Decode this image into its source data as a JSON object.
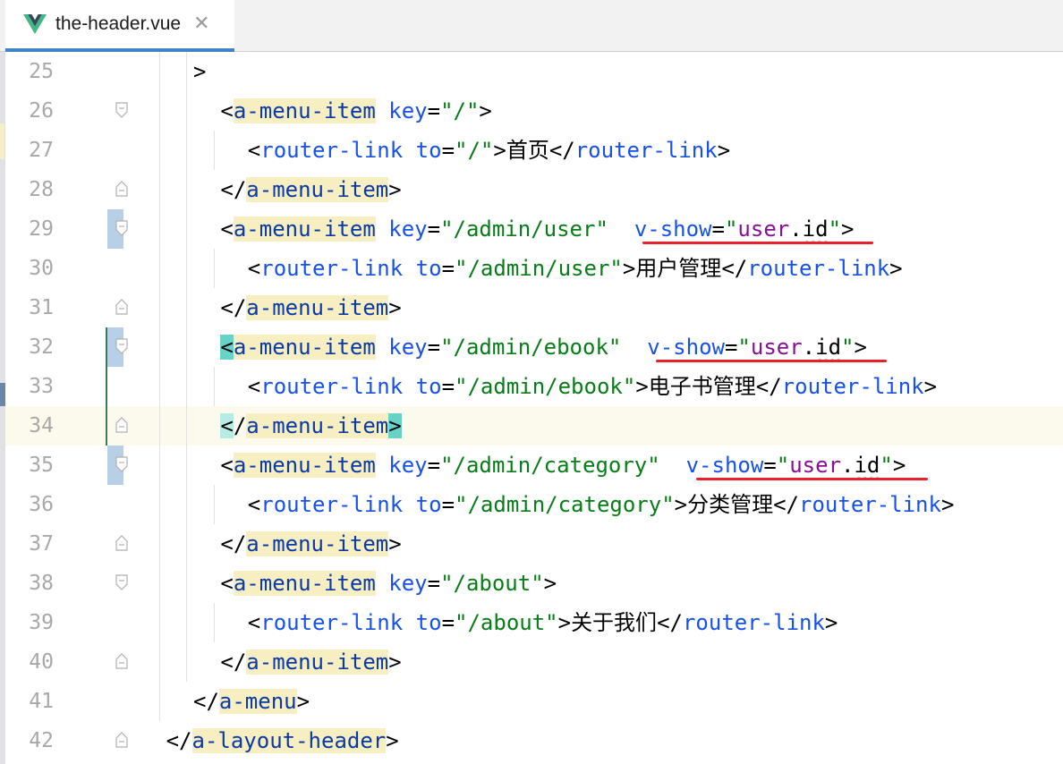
{
  "tab": {
    "title": "the-header.vue",
    "close_glyph": "✕",
    "icon": "vue-logo-icon",
    "icon_colors": {
      "outer": "#41b883",
      "inner": "#34495e"
    }
  },
  "editor": {
    "current_line": 34,
    "lines": [
      {
        "n": "25",
        "indent": 0,
        "parts": [
          [
            "punct",
            ">"
          ]
        ]
      },
      {
        "n": "26",
        "indent": 1,
        "parts": [
          [
            "punct",
            "<"
          ],
          [
            "tag",
            "a-menu-item"
          ],
          [
            "txt",
            " "
          ],
          [
            "attr",
            "key"
          ],
          [
            "punct",
            "="
          ],
          [
            "val",
            "\"/\""
          ],
          [
            "punct",
            ">"
          ]
        ]
      },
      {
        "n": "27",
        "indent": 2,
        "parts": [
          [
            "punct",
            "<"
          ],
          [
            "attr",
            "router-link"
          ],
          [
            "txt",
            " "
          ],
          [
            "attr",
            "to"
          ],
          [
            "punct",
            "="
          ],
          [
            "val",
            "\"/\""
          ],
          [
            "punct",
            ">"
          ],
          [
            "txt",
            "首页"
          ],
          [
            "punct",
            "</"
          ],
          [
            "attr",
            "router-link"
          ],
          [
            "punct",
            ">"
          ]
        ]
      },
      {
        "n": "28",
        "indent": 1,
        "parts": [
          [
            "punct",
            "</"
          ],
          [
            "tag",
            "a-menu-item"
          ],
          [
            "punct",
            ">"
          ]
        ]
      },
      {
        "n": "29",
        "indent": 1,
        "parts": [
          [
            "punct",
            "<"
          ],
          [
            "tag",
            "a-menu-item"
          ],
          [
            "txt",
            " "
          ],
          [
            "attr",
            "key"
          ],
          [
            "punct",
            "="
          ],
          [
            "val",
            "\"/admin/user\""
          ],
          [
            "txt",
            "  "
          ],
          [
            "attr",
            "v-show"
          ],
          [
            "punct",
            "="
          ],
          [
            "val",
            "\""
          ],
          [
            "var",
            "user"
          ],
          [
            "punct",
            "."
          ],
          [
            "squig",
            "id"
          ],
          [
            "val",
            "\""
          ],
          [
            "punct",
            ">"
          ]
        ]
      },
      {
        "n": "30",
        "indent": 2,
        "parts": [
          [
            "punct",
            "<"
          ],
          [
            "attr",
            "router-link"
          ],
          [
            "txt",
            " "
          ],
          [
            "attr",
            "to"
          ],
          [
            "punct",
            "="
          ],
          [
            "val",
            "\"/admin/user\""
          ],
          [
            "punct",
            ">"
          ],
          [
            "txt",
            "用户管理"
          ],
          [
            "punct",
            "</"
          ],
          [
            "attr",
            "router-link"
          ],
          [
            "punct",
            ">"
          ]
        ]
      },
      {
        "n": "31",
        "indent": 1,
        "parts": [
          [
            "punct",
            "</"
          ],
          [
            "tag",
            "a-menu-item"
          ],
          [
            "punct",
            ">"
          ]
        ]
      },
      {
        "n": "32",
        "indent": 1,
        "parts": [
          [
            "bracket",
            "<"
          ],
          [
            "tag",
            "a-menu-item"
          ],
          [
            "txt",
            " "
          ],
          [
            "attr",
            "key"
          ],
          [
            "punct",
            "="
          ],
          [
            "val",
            "\"/admin/ebook\""
          ],
          [
            "txt",
            "  "
          ],
          [
            "attr",
            "v-show"
          ],
          [
            "punct",
            "="
          ],
          [
            "val",
            "\""
          ],
          [
            "var",
            "user"
          ],
          [
            "punct",
            "."
          ],
          [
            "squig",
            "id"
          ],
          [
            "val",
            "\""
          ],
          [
            "punct",
            ">"
          ]
        ]
      },
      {
        "n": "33",
        "indent": 2,
        "parts": [
          [
            "punct",
            "<"
          ],
          [
            "attr",
            "router-link"
          ],
          [
            "txt",
            " "
          ],
          [
            "attr",
            "to"
          ],
          [
            "punct",
            "="
          ],
          [
            "val",
            "\"/admin/ebook\""
          ],
          [
            "punct",
            ">"
          ],
          [
            "txt",
            "电子书管理"
          ],
          [
            "punct",
            "</"
          ],
          [
            "attr",
            "router-link"
          ],
          [
            "punct",
            ">"
          ]
        ]
      },
      {
        "n": "34",
        "indent": 1,
        "parts": [
          [
            "bracketsoft",
            "<"
          ],
          [
            "punct",
            "/"
          ],
          [
            "tag",
            "a-menu-item"
          ],
          [
            "bracket",
            ">"
          ]
        ]
      },
      {
        "n": "35",
        "indent": 1,
        "parts": [
          [
            "punct",
            "<"
          ],
          [
            "tag",
            "a-menu-item"
          ],
          [
            "txt",
            " "
          ],
          [
            "attr",
            "key"
          ],
          [
            "punct",
            "="
          ],
          [
            "val",
            "\"/admin/category\""
          ],
          [
            "txt",
            "  "
          ],
          [
            "attr",
            "v-show"
          ],
          [
            "punct",
            "="
          ],
          [
            "val",
            "\""
          ],
          [
            "var",
            "user"
          ],
          [
            "punct",
            "."
          ],
          [
            "squig",
            "id"
          ],
          [
            "val",
            "\""
          ],
          [
            "punct",
            ">"
          ]
        ]
      },
      {
        "n": "36",
        "indent": 2,
        "parts": [
          [
            "punct",
            "<"
          ],
          [
            "attr",
            "router-link"
          ],
          [
            "txt",
            " "
          ],
          [
            "attr",
            "to"
          ],
          [
            "punct",
            "="
          ],
          [
            "val",
            "\"/admin/category\""
          ],
          [
            "punct",
            ">"
          ],
          [
            "txt",
            "分类管理"
          ],
          [
            "punct",
            "</"
          ],
          [
            "attr",
            "router-link"
          ],
          [
            "punct",
            ">"
          ]
        ]
      },
      {
        "n": "37",
        "indent": 1,
        "parts": [
          [
            "punct",
            "</"
          ],
          [
            "tag",
            "a-menu-item"
          ],
          [
            "punct",
            ">"
          ]
        ]
      },
      {
        "n": "38",
        "indent": 1,
        "parts": [
          [
            "punct",
            "<"
          ],
          [
            "tag",
            "a-menu-item"
          ],
          [
            "txt",
            " "
          ],
          [
            "attr",
            "key"
          ],
          [
            "punct",
            "="
          ],
          [
            "val",
            "\"/about\""
          ],
          [
            "punct",
            ">"
          ]
        ]
      },
      {
        "n": "39",
        "indent": 2,
        "parts": [
          [
            "punct",
            "<"
          ],
          [
            "attr",
            "router-link"
          ],
          [
            "txt",
            " "
          ],
          [
            "attr",
            "to"
          ],
          [
            "punct",
            "="
          ],
          [
            "val",
            "\"/about\""
          ],
          [
            "punct",
            ">"
          ],
          [
            "txt",
            "关于我们"
          ],
          [
            "punct",
            "</"
          ],
          [
            "attr",
            "router-link"
          ],
          [
            "punct",
            ">"
          ]
        ]
      },
      {
        "n": "40",
        "indent": 1,
        "parts": [
          [
            "punct",
            "</"
          ],
          [
            "tag",
            "a-menu-item"
          ],
          [
            "punct",
            ">"
          ]
        ]
      },
      {
        "n": "41",
        "indent": 0,
        "parts": [
          [
            "punct",
            "</"
          ],
          [
            "tag",
            "a-menu"
          ],
          [
            "punct",
            ">"
          ]
        ]
      },
      {
        "n": "42",
        "indent": -1,
        "parts": [
          [
            "punct",
            "</"
          ],
          [
            "tag",
            "a-layout-header"
          ],
          [
            "punct",
            ">"
          ]
        ]
      }
    ]
  }
}
